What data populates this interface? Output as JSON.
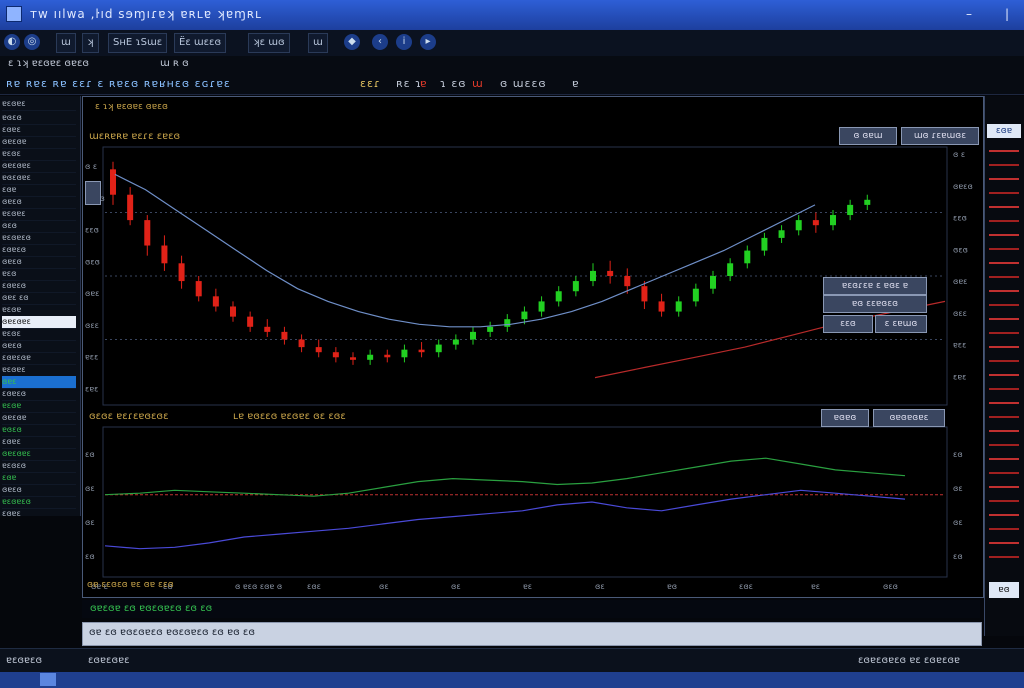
{
  "window": {
    "title": "ᴛᴡ ıılwa ,ŀıd sɘɱıɾɐʞ ɐʀʟɐ ʞɐɱʀʟ"
  },
  "toolbar": {
    "items": [
      "ɯ",
      "ʞ",
      "ЅнЕ ɿЅɯɛ",
      "Ёɛ ɯɛɛɞ",
      "ʞɛ ɯɞ",
      "ɯ"
    ]
  },
  "ticker": {
    "label": "ʀɐ ʀɐɛ ʀɐ ɛɛɾ ɛ ʀɐɛɞ ʀɐʁʜɛɞ ɛɢɾɐɛ",
    "values": [
      "ɛɛɾ",
      "ʀɛ ɿ",
      "ɐ",
      "ɿ ɛɞ",
      "ɯ",
      "ɞ ɯɛɛɞ",
      "ɐ"
    ]
  },
  "top_strip": {
    "left": "ɛ ɿʞ ɐɛɞɐɛ ɞɐɛɞ",
    "right": "ɯ ʀ ɞ"
  },
  "price_panel": {
    "title": "ɯɛʀɐʀɐ ɐɛɾɛ ɛɐɛɞ",
    "buttons": [
      "ɞ ɞɐɯ",
      "ɯɞ ɾɛɐɯɞɛ"
    ],
    "side_buttons": [
      "ɐɛɞɾɛɐ ɛ ɐɞɛ ɐ",
      "ɐɞ ɛɛɐɞɛɞ",
      "ɛɛɞ",
      "ɛ ɛɐɯɞ"
    ],
    "y_labels": [
      "ɞ ɛ",
      "ɞɐɛɞ",
      "ɛɛɞ",
      "ɞɛɞ",
      "ɞɐɛ",
      "ɞɛɛ",
      "ɐɛɛ",
      "ɛɐɛ"
    ]
  },
  "indicator_panel": {
    "title": "ɞɛɞɛ ɐɛɾɛɐɞɛɞɛ",
    "subtitle": "ʟɐ ɐɞɛɛɞ ɐɛɞɐɛ ɞɛ ɛɞɛ",
    "buttons": [
      "ɐɞɐɞ",
      "ɞɐɞɐɞɐɛ"
    ],
    "y_labels": [
      "ɛɞ",
      "ɞɛ",
      "ɞɛ",
      "ɛɞ"
    ],
    "note": "ɞɐ ɛɛɞɛɞ ɐɛ ɞɐ ɛɛɞ"
  },
  "x_axis": {
    "labels": [
      "ɞɐ ɛ",
      "ɛɞ",
      "ɞ ɐɛɞ ɛɞɐ ɞ",
      "ɛɞɛ",
      "ɞɛ",
      "ɞɛ",
      "ɐɛ",
      "ɞɛ",
      "ɐɞ",
      "ɛɞɛ",
      "ɐɛ",
      "ɞɛɞ"
    ]
  },
  "info_line": "ɞɐɛɞɐ ɛɞ ɐɞɛɞɐɛɞ ɛɞ ɛɞ",
  "bottom_bar": "ɞɐ ɛɞ ɐɞɛɞɐɛɞ ɐɞɛɞɐɛɞ ɛɞ ɐɞ ɛɞ",
  "left_panel": {
    "header": "ɐɛɞɐɛ",
    "items": [
      "ɐɞɛɞ",
      "ɛɞɐɛ",
      "ɞɐɛɞɐ",
      "ɐɛɞɛ",
      "ɞɐɛɞɐɛ",
      "ɐɞɛɞɐɛ",
      "ɛɞɐ",
      "ɞɐɛɞ",
      "ɐɛɞɐɛ",
      "ɞɛɞ",
      "ɐɛɞɐɛɞ",
      "ɛɞɐɛɞ",
      "ɞɐɛɞ",
      "ɐɛɞ",
      "ɛɞɐɛɞ",
      "ɞɐɛ ɛɞ",
      "ɐɛɞɐ",
      "ɞɐɛɞɐɛ",
      "ɐɛɞɛ",
      "ɞɐɛɞ",
      "ɛɞɐɛɞɐ",
      "ɐɛɞɐɛ",
      "ɞɐɛ",
      "ɛɞɐɛɞ",
      "ɐɛɞɐ",
      "ɞɐɛɞɐ",
      "ɐɞɛɞ",
      "ɛɞɐɛ",
      "ɞɐɛɞɐɛ",
      "ɐɛɞɛɞ",
      "ɛɞɐ",
      "ɞɐɛɞ",
      "ɐɛɞɐɛɞ",
      "ɛɞɐɛ"
    ],
    "selected_index": 17,
    "highlight_index": 22
  },
  "right_panel": {
    "header": "ɛɞɐ",
    "footer": "ɐɞ"
  },
  "status": {
    "left": "ɐɛɞɐɛɞ",
    "middle": "ɛɞɐɛɞɐɛ",
    "right": "ɛɞɐɛɞɐɛɞ ɐɛ ɛɞɐɛɞɐ"
  },
  "colors": {
    "up": "#22d022",
    "down": "#e02218",
    "ma": "#6f8fc8",
    "accent": "#2e5fd6"
  },
  "chart_data": {
    "type": "line",
    "candles": [
      {
        "o": 0.92,
        "c": 0.82,
        "h": 0.95,
        "l": 0.78
      },
      {
        "o": 0.82,
        "c": 0.72,
        "h": 0.85,
        "l": 0.7
      },
      {
        "o": 0.72,
        "c": 0.62,
        "h": 0.74,
        "l": 0.58
      },
      {
        "o": 0.62,
        "c": 0.55,
        "h": 0.66,
        "l": 0.52
      },
      {
        "o": 0.55,
        "c": 0.48,
        "h": 0.58,
        "l": 0.45
      },
      {
        "o": 0.48,
        "c": 0.42,
        "h": 0.5,
        "l": 0.4
      },
      {
        "o": 0.42,
        "c": 0.38,
        "h": 0.45,
        "l": 0.36
      },
      {
        "o": 0.38,
        "c": 0.34,
        "h": 0.4,
        "l": 0.32
      },
      {
        "o": 0.34,
        "c": 0.3,
        "h": 0.36,
        "l": 0.28
      },
      {
        "o": 0.3,
        "c": 0.28,
        "h": 0.33,
        "l": 0.26
      },
      {
        "o": 0.28,
        "c": 0.25,
        "h": 0.3,
        "l": 0.23
      },
      {
        "o": 0.25,
        "c": 0.22,
        "h": 0.27,
        "l": 0.2
      },
      {
        "o": 0.22,
        "c": 0.2,
        "h": 0.25,
        "l": 0.18
      },
      {
        "o": 0.2,
        "c": 0.18,
        "h": 0.22,
        "l": 0.16
      },
      {
        "o": 0.18,
        "c": 0.17,
        "h": 0.2,
        "l": 0.15
      },
      {
        "o": 0.17,
        "c": 0.19,
        "h": 0.21,
        "l": 0.15
      },
      {
        "o": 0.19,
        "c": 0.18,
        "h": 0.21,
        "l": 0.16
      },
      {
        "o": 0.18,
        "c": 0.21,
        "h": 0.23,
        "l": 0.16
      },
      {
        "o": 0.21,
        "c": 0.2,
        "h": 0.24,
        "l": 0.18
      },
      {
        "o": 0.2,
        "c": 0.23,
        "h": 0.25,
        "l": 0.18
      },
      {
        "o": 0.23,
        "c": 0.25,
        "h": 0.27,
        "l": 0.21
      },
      {
        "o": 0.25,
        "c": 0.28,
        "h": 0.3,
        "l": 0.23
      },
      {
        "o": 0.28,
        "c": 0.3,
        "h": 0.32,
        "l": 0.26
      },
      {
        "o": 0.3,
        "c": 0.33,
        "h": 0.35,
        "l": 0.28
      },
      {
        "o": 0.33,
        "c": 0.36,
        "h": 0.38,
        "l": 0.31
      },
      {
        "o": 0.36,
        "c": 0.4,
        "h": 0.42,
        "l": 0.34
      },
      {
        "o": 0.4,
        "c": 0.44,
        "h": 0.46,
        "l": 0.38
      },
      {
        "o": 0.44,
        "c": 0.48,
        "h": 0.5,
        "l": 0.42
      },
      {
        "o": 0.48,
        "c": 0.52,
        "h": 0.55,
        "l": 0.46
      },
      {
        "o": 0.52,
        "c": 0.5,
        "h": 0.56,
        "l": 0.47
      },
      {
        "o": 0.5,
        "c": 0.46,
        "h": 0.53,
        "l": 0.43
      },
      {
        "o": 0.46,
        "c": 0.4,
        "h": 0.48,
        "l": 0.37
      },
      {
        "o": 0.4,
        "c": 0.36,
        "h": 0.43,
        "l": 0.34
      },
      {
        "o": 0.36,
        "c": 0.4,
        "h": 0.42,
        "l": 0.34
      },
      {
        "o": 0.4,
        "c": 0.45,
        "h": 0.47,
        "l": 0.38
      },
      {
        "o": 0.45,
        "c": 0.5,
        "h": 0.52,
        "l": 0.43
      },
      {
        "o": 0.5,
        "c": 0.55,
        "h": 0.57,
        "l": 0.48
      },
      {
        "o": 0.55,
        "c": 0.6,
        "h": 0.62,
        "l": 0.53
      },
      {
        "o": 0.6,
        "c": 0.65,
        "h": 0.67,
        "l": 0.58
      },
      {
        "o": 0.65,
        "c": 0.68,
        "h": 0.7,
        "l": 0.63
      },
      {
        "o": 0.68,
        "c": 0.72,
        "h": 0.74,
        "l": 0.66
      },
      {
        "o": 0.72,
        "c": 0.7,
        "h": 0.75,
        "l": 0.67
      },
      {
        "o": 0.7,
        "c": 0.74,
        "h": 0.76,
        "l": 0.68
      },
      {
        "o": 0.74,
        "c": 0.78,
        "h": 0.8,
        "l": 0.72
      },
      {
        "o": 0.78,
        "c": 0.8,
        "h": 0.82,
        "l": 0.76
      }
    ],
    "ma_line": [
      0.9,
      0.84,
      0.76,
      0.68,
      0.6,
      0.52,
      0.45,
      0.4,
      0.36,
      0.33,
      0.31,
      0.3,
      0.3,
      0.31,
      0.33,
      0.36,
      0.4,
      0.45,
      0.5,
      0.55,
      0.6,
      0.66,
      0.72,
      0.78
    ],
    "trend_line": [
      0.1,
      0.14,
      0.18,
      0.22,
      0.27,
      0.32,
      0.36,
      0.4
    ],
    "osc_a": [
      0.55,
      0.56,
      0.58,
      0.57,
      0.56,
      0.55,
      0.54,
      0.56,
      0.6,
      0.64,
      0.66,
      0.65,
      0.64,
      0.62,
      0.63,
      0.66,
      0.7,
      0.74,
      0.78,
      0.8,
      0.76,
      0.72,
      0.7,
      0.68
    ],
    "osc_b": [
      0.2,
      0.18,
      0.19,
      0.22,
      0.26,
      0.28,
      0.3,
      0.32,
      0.35,
      0.38,
      0.4,
      0.42,
      0.44,
      0.48,
      0.5,
      0.46,
      0.44,
      0.48,
      0.52,
      0.55,
      0.58,
      0.56,
      0.54,
      0.52
    ]
  }
}
